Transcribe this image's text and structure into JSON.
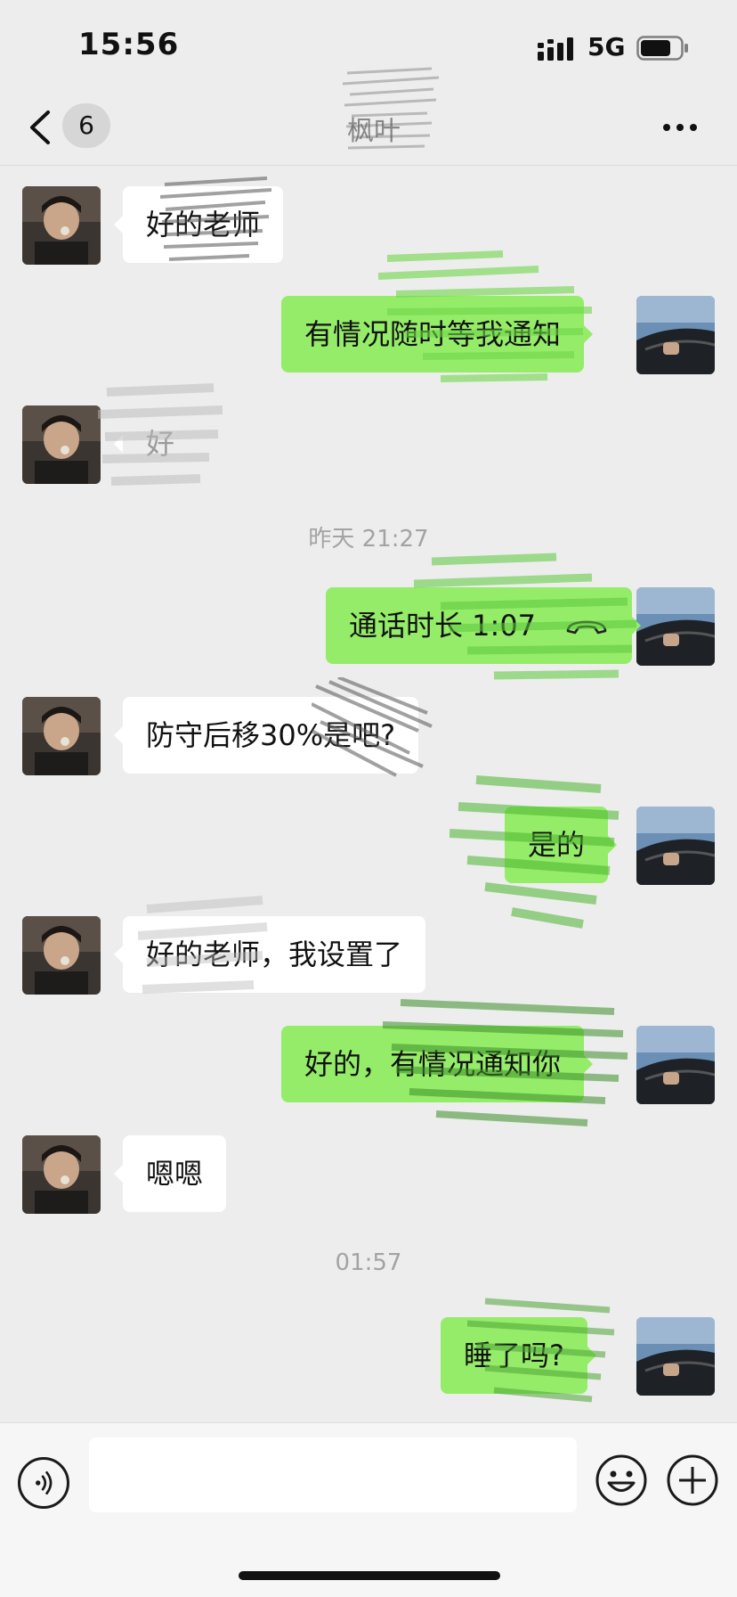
{
  "status_bar": {
    "time": "15:56",
    "network": "5G",
    "icons": [
      "signal-icon",
      "battery-icon"
    ]
  },
  "nav": {
    "unread_count": "6",
    "title": "枫叶",
    "icons": [
      "back-icon",
      "more-icon"
    ]
  },
  "messages": [
    {
      "side": "left",
      "text": "好的老师"
    },
    {
      "side": "right",
      "text": "有情况随时等我通知"
    },
    {
      "side": "left",
      "text": "好"
    },
    {
      "type": "time",
      "text": "昨天 21:27"
    },
    {
      "side": "right",
      "text": "通话时长 1:07",
      "icon": "phone-hangup-icon"
    },
    {
      "side": "left",
      "text": "防守后移30%是吧?"
    },
    {
      "side": "right",
      "text": "是的"
    },
    {
      "side": "left",
      "text": "好的老师，我设置了"
    },
    {
      "side": "right",
      "text": "好的，有情况通知你"
    },
    {
      "side": "left",
      "text": "嗯嗯"
    },
    {
      "type": "time",
      "text": "01:57"
    },
    {
      "side": "right",
      "text": "睡了吗?"
    }
  ],
  "input_bar": {
    "placeholder": "",
    "icons": [
      "voice-icon",
      "emoji-icon",
      "plus-icon"
    ]
  },
  "colors": {
    "background": "#ededed",
    "sent_bubble": "#95ec69",
    "received_bubble": "#ffffff",
    "timestamp": "#a3a3a3"
  }
}
